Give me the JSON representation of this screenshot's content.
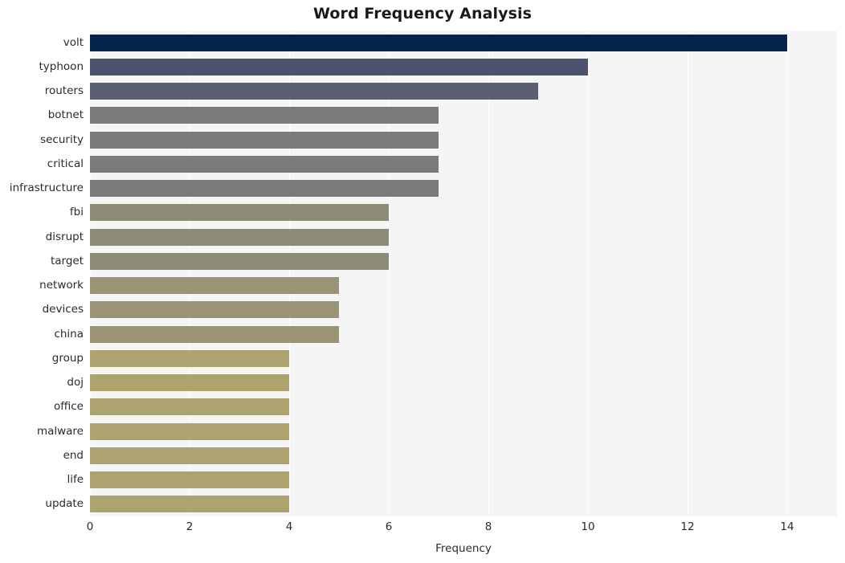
{
  "chart_data": {
    "type": "bar",
    "orientation": "horizontal",
    "title": "Word Frequency Analysis",
    "xlabel": "Frequency",
    "ylabel": "",
    "categories": [
      "volt",
      "typhoon",
      "routers",
      "botnet",
      "security",
      "critical",
      "infrastructure",
      "fbi",
      "disrupt",
      "target",
      "network",
      "devices",
      "china",
      "group",
      "doj",
      "office",
      "malware",
      "end",
      "life",
      "update"
    ],
    "values": [
      14,
      10,
      9,
      7,
      7,
      7,
      7,
      6,
      6,
      6,
      5,
      5,
      5,
      4,
      4,
      4,
      4,
      4,
      4,
      4
    ],
    "bar_colors": [
      "#04234d",
      "#4d536d",
      "#5b5f71",
      "#7b7b79",
      "#7b7b79",
      "#7b7b79",
      "#7b7b79",
      "#8e8b78",
      "#8e8b78",
      "#8e8b78",
      "#9a9476",
      "#9a9476",
      "#9a9476",
      "#ada36e",
      "#ada36e",
      "#ada36e",
      "#ada36e",
      "#ada36e",
      "#ada36e",
      "#ada36e"
    ],
    "xlim": [
      0,
      15
    ],
    "xticks": [
      0,
      2,
      4,
      6,
      8,
      10,
      12,
      14
    ],
    "xtick_labels": [
      "0",
      "2",
      "4",
      "6",
      "8",
      "10",
      "12",
      "14"
    ],
    "grid": true,
    "grid_axis": "x",
    "legend": "none",
    "plot_background": "#f5f5f6",
    "figure_background": "#ffffff",
    "gridline_color": "#ffffff",
    "text_color": "#2b2b2b",
    "title_color": "#1a1a1a"
  }
}
